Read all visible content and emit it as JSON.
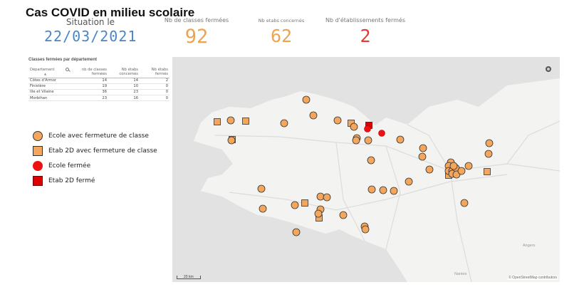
{
  "app": {
    "title": "Cas COVID en milieu scolaire"
  },
  "kpis": {
    "situation_label": "Situation le",
    "situation_date": "22/03/2021",
    "classes_label": "Nb de classes fermées",
    "classes_value": "92",
    "etabs_label": "Nb etabs concernés",
    "etabs_value": "62",
    "closed_label": "Nb d'établissements fermés",
    "closed_value": "2"
  },
  "table": {
    "title": "Classes fermées par département",
    "headers": [
      "Département",
      "nb de classes fermées",
      "Nb étabs concernés",
      "Nb étabs fermés"
    ],
    "rows": [
      [
        "Côtes d'Armor",
        "14",
        "14",
        "2"
      ],
      [
        "Finistère",
        "19",
        "10",
        "0"
      ],
      [
        "Ille et Vilaine",
        "36",
        "23",
        "0"
      ],
      [
        "Morbihan",
        "23",
        "16",
        "0"
      ]
    ]
  },
  "legend": [
    {
      "label": "Ecole avec fermeture de classe",
      "symbol": "orange-circle"
    },
    {
      "label": "Etab 2D avec fermeture de classe",
      "symbol": "orange-square"
    },
    {
      "label": "Ecole fermée",
      "symbol": "red-circle"
    },
    {
      "label": "Etab 2D fermé",
      "symbol": "red-square"
    }
  ],
  "map": {
    "scale_label": "20 km",
    "credit": "© OpenStreetMap contributors",
    "cities": [
      "Angers",
      "Nantes"
    ]
  },
  "colors": {
    "kpi_date": "#4a86c5",
    "kpi_orange": "#f0a24c",
    "kpi_red": "#e53935",
    "marker_orange": "#f4a65c",
    "marker_red": "#ee1111"
  },
  "icons": [
    "search-icon",
    "map-settings-icon"
  ]
}
